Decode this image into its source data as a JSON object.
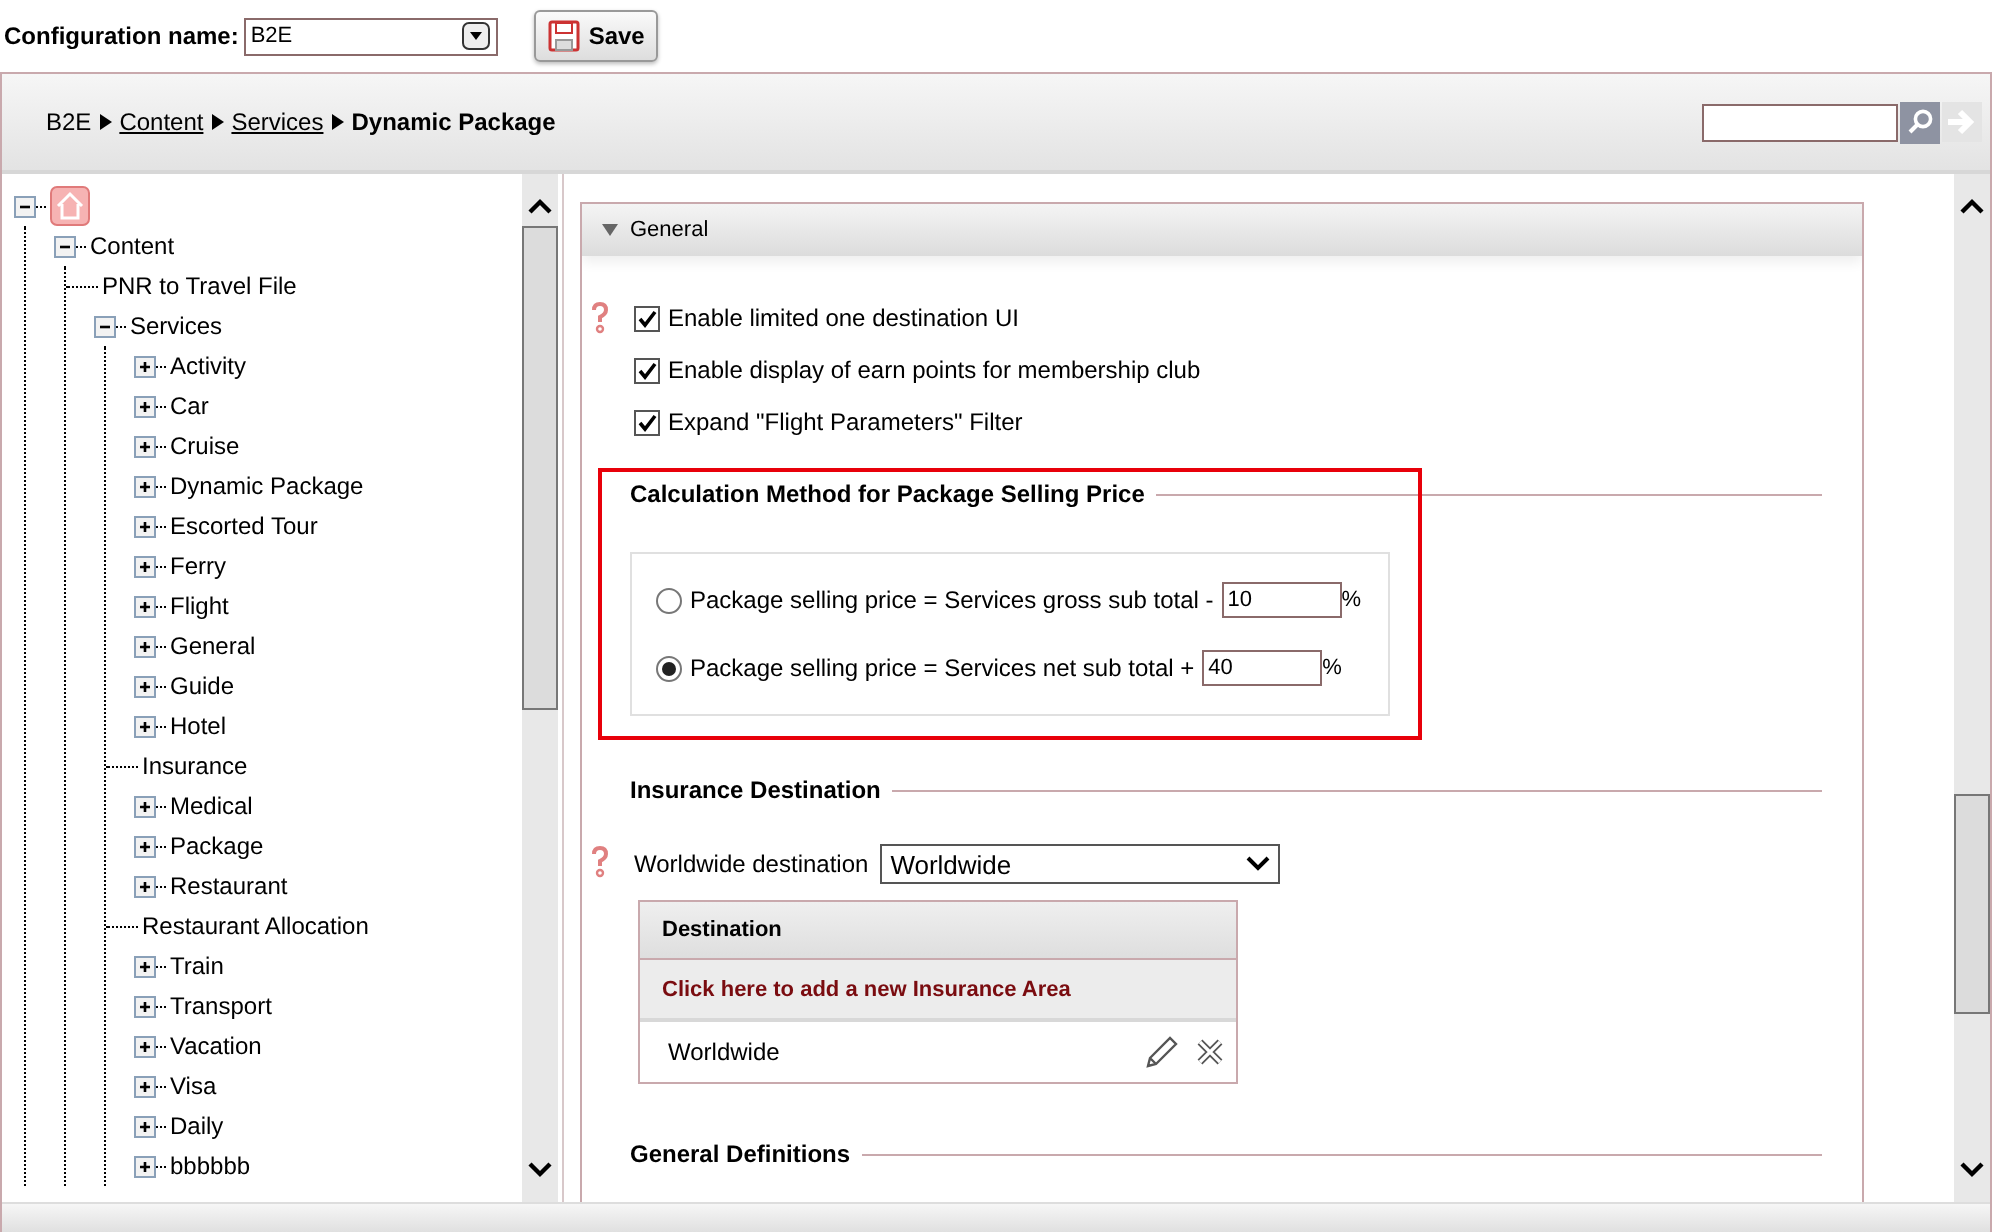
{
  "config": {
    "label": "Configuration name:",
    "value": "B2E",
    "save_label": "Save"
  },
  "breadcrumb": [
    {
      "label": "B2E",
      "kind": "text"
    },
    {
      "label": "Content",
      "kind": "link"
    },
    {
      "label": "Services",
      "kind": "link"
    },
    {
      "label": "Dynamic Package",
      "kind": "current"
    }
  ],
  "tree": [
    {
      "kind": "home",
      "expanded": true,
      "children": [
        {
          "label": "Content",
          "kind": "folder",
          "expanded": true,
          "children": [
            {
              "label": "PNR to Travel File",
              "kind": "leaf"
            },
            {
              "label": "Services",
              "kind": "folder",
              "expanded": true,
              "children": [
                {
                  "label": "Activity",
                  "kind": "folder",
                  "expanded": false
                },
                {
                  "label": "Car",
                  "kind": "folder",
                  "expanded": false
                },
                {
                  "label": "Cruise",
                  "kind": "folder",
                  "expanded": false
                },
                {
                  "label": "Dynamic Package",
                  "kind": "folder",
                  "expanded": false
                },
                {
                  "label": "Escorted Tour",
                  "kind": "folder",
                  "expanded": false
                },
                {
                  "label": "Ferry",
                  "kind": "folder",
                  "expanded": false
                },
                {
                  "label": "Flight",
                  "kind": "folder",
                  "expanded": false
                },
                {
                  "label": "General",
                  "kind": "folder",
                  "expanded": false
                },
                {
                  "label": "Guide",
                  "kind": "folder",
                  "expanded": false
                },
                {
                  "label": "Hotel",
                  "kind": "folder",
                  "expanded": false
                },
                {
                  "label": "Insurance",
                  "kind": "leaf"
                },
                {
                  "label": "Medical",
                  "kind": "folder",
                  "expanded": false
                },
                {
                  "label": "Package",
                  "kind": "folder",
                  "expanded": false
                },
                {
                  "label": "Restaurant",
                  "kind": "folder",
                  "expanded": false
                },
                {
                  "label": "Restaurant Allocation",
                  "kind": "leaf"
                },
                {
                  "label": "Train",
                  "kind": "folder",
                  "expanded": false
                },
                {
                  "label": "Transport",
                  "kind": "folder",
                  "expanded": false
                },
                {
                  "label": "Vacation",
                  "kind": "folder",
                  "expanded": false
                },
                {
                  "label": "Visa",
                  "kind": "folder",
                  "expanded": false
                },
                {
                  "label": "Daily",
                  "kind": "folder",
                  "expanded": false
                },
                {
                  "label": "bbbbbb",
                  "kind": "folder",
                  "expanded": false
                }
              ]
            }
          ]
        }
      ]
    }
  ],
  "section": {
    "title": "General",
    "expanded": true
  },
  "options": [
    {
      "label": "Enable limited one destination UI",
      "checked": true,
      "help": true
    },
    {
      "label": "Enable display of earn points for membership club",
      "checked": true,
      "help": false
    },
    {
      "label": "Expand \"Flight Parameters\" Filter",
      "checked": true,
      "help": false
    }
  ],
  "calculation": {
    "title": "Calculation Method for Package Selling Price",
    "methods": [
      {
        "label": "Package selling price = Services gross sub total -",
        "value": "10",
        "unit": "%",
        "selected": false
      },
      {
        "label": "Package selling price = Services net sub total +",
        "value": "40",
        "unit": "%",
        "selected": true
      }
    ]
  },
  "insurance": {
    "title": "Insurance Destination",
    "field_label": "Worldwide destination",
    "field_value": "Worldwide",
    "table_header": "Destination",
    "add_link": "Click here to add a new Insurance Area",
    "rows": [
      "Worldwide"
    ]
  },
  "general_definitions": {
    "title": "General Definitions"
  }
}
